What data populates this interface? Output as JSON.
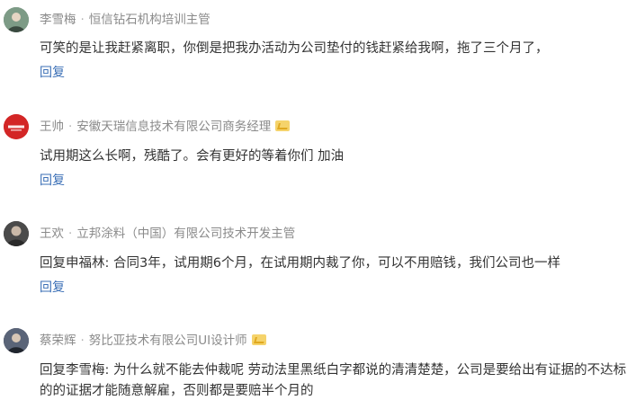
{
  "comments": [
    {
      "author": "李雪梅",
      "title": "恒信钻石机构培训主管",
      "verified": false,
      "text": "可笑的是让我赶紧离职，你倒是把我办活动为公司垫付的钱赶紧给我啊，拖了三个月了，",
      "reply_label": "回复",
      "avatar_icon": "avatar-photo"
    },
    {
      "author": "王帅",
      "title": "安徽天瑞信息技术有限公司商务经理",
      "verified": true,
      "text": "试用期这么长啊，残酷了。会有更好的等着你们 加油",
      "reply_label": "回复",
      "avatar_icon": "company-logo"
    },
    {
      "author": "王欢",
      "title": "立邦涂料（中国）有限公司技术开发主管",
      "verified": false,
      "text": "回复申福林: 合同3年，试用期6个月，在试用期内裁了你，可以不用赔钱，我们公司也一样",
      "reply_label": "回复",
      "avatar_icon": "avatar-photo"
    },
    {
      "author": "蔡荣辉",
      "title": "努比亚技术有限公司UI设计师",
      "verified": true,
      "text": "回复李雪梅: 为什么就不能去仲裁呢 劳动法里黑纸白字都说的清清楚楚，公司是要给出有证据的不达标的的证据才能随意解雇，否则都是要赔半个月的",
      "reply_label": "",
      "avatar_icon": "avatar-photo"
    }
  ],
  "separator": "·",
  "colors": {
    "name": "#8a8a8a",
    "text": "#333333",
    "link": "#3b6fb6",
    "badge": "#f5d36b"
  }
}
